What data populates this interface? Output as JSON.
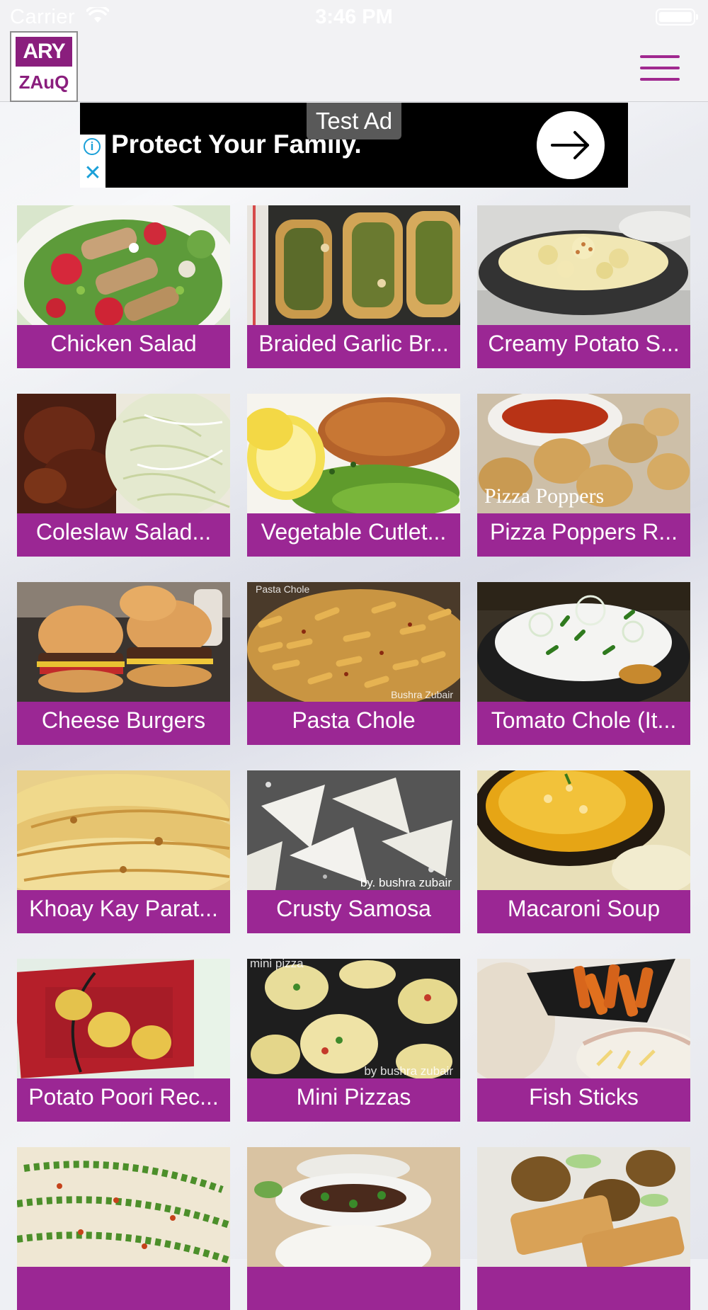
{
  "status_bar": {
    "carrier": "Carrier",
    "time": "3:46 PM"
  },
  "header": {
    "logo_top": "ARY",
    "logo_bottom": "ZAuQ",
    "menu_icon": "hamburger-menu-icon",
    "accent_color": "#9b2794"
  },
  "ad": {
    "tag": "Test Ad",
    "headline": "Protect Your Family.",
    "info_icon": "info-icon",
    "close_icon": "close-icon",
    "arrow_icon": "arrow-right-icon"
  },
  "recipes": [
    {
      "title": "Chicken Salad"
    },
    {
      "title": "Braided Garlic Br..."
    },
    {
      "title": "Creamy Potato S..."
    },
    {
      "title": "Coleslaw Salad..."
    },
    {
      "title": "Vegetable Cutlet..."
    },
    {
      "title": "Pizza Poppers R...",
      "image_caption": "Pizza Poppers"
    },
    {
      "title": "Cheese Burgers"
    },
    {
      "title": "Pasta Chole",
      "image_caption": "Pasta Chole",
      "image_credit": "Bushra Zubair"
    },
    {
      "title": "Tomato Chole (It..."
    },
    {
      "title": "Khoay Kay Parat..."
    },
    {
      "title": "Crusty Samosa",
      "image_credit": "by. bushra zubair"
    },
    {
      "title": "Macaroni Soup"
    },
    {
      "title": "Potato Poori Rec..."
    },
    {
      "title": "Mini Pizzas",
      "image_caption": "mini pizza",
      "image_credit": "by bushra zubair"
    },
    {
      "title": "Fish Sticks"
    },
    {
      "title": ""
    },
    {
      "title": ""
    },
    {
      "title": ""
    }
  ]
}
